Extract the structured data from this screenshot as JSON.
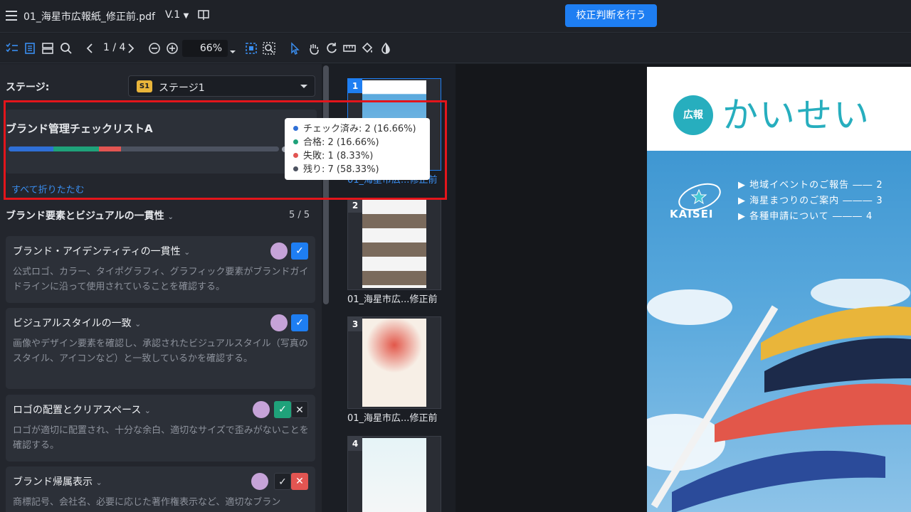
{
  "header": {
    "file_name": "01_海星市広報紙_修正前.pdf",
    "version": "V.1",
    "proof_button": "校正判断を行う"
  },
  "toolbar": {
    "page_indicator": "1 / 4",
    "zoom": "66%"
  },
  "stage": {
    "label": "ステージ:",
    "badge": "S1",
    "selected": "ステージ1"
  },
  "checklist": {
    "title": "ブランド管理チェックリストA",
    "collapse_all": "すべて折りたたむ",
    "progress": [
      {
        "name": "checked",
        "fraction": 0.1666,
        "color": "#2f6fd6"
      },
      {
        "name": "passed",
        "fraction": 0.1666,
        "color": "#1fa27a"
      },
      {
        "name": "failed",
        "fraction": 0.0833,
        "color": "#e25552"
      }
    ],
    "tooltip": [
      {
        "label": "チェック済み: 2 (16.66%)",
        "color": "#2f6fd6"
      },
      {
        "label": "合格: 2 (16.66%)",
        "color": "#1fa27a"
      },
      {
        "label": "失敗: 1 (8.33%)",
        "color": "#e25552"
      },
      {
        "label": "残り: 7 (58.33%)",
        "color": "#4c5260"
      }
    ]
  },
  "section": {
    "title": "ブランド要素とビジュアルの一貫性",
    "count": "5 / 5"
  },
  "items": [
    {
      "title": "ブランド・アイデンティティの一貫性",
      "desc": "公式ロゴ、カラー、タイポグラフィ、グラフィック要素がブランドガイドラインに沿って使用されていることを確認する。"
    },
    {
      "title": "ビジュアルスタイルの一致",
      "desc": "画像やデザイン要素を確認し、承認されたビジュアルスタイル（写真のスタイル、アイコンなど）と一致しているかを確認する。"
    },
    {
      "title": "ロゴの配置とクリアスペース",
      "desc": "ロゴが適切に配置され、十分な余白、適切なサイズで歪みがないことを確認する。"
    },
    {
      "title": "ブランド帰属表示",
      "desc": "商標記号、会社名、必要に応じた著作権表示など、適切なブラン"
    }
  ],
  "thumbnails": [
    {
      "num": "1",
      "caption": "01_海星市広...修正前"
    },
    {
      "num": "2",
      "caption": "01_海星市広...修正前"
    },
    {
      "num": "3",
      "caption": "01_海星市広...修正前"
    },
    {
      "num": "4",
      "caption": ""
    }
  ],
  "document": {
    "koho": "広報",
    "brand_title": "かいせい",
    "kaisei": "KAISEI",
    "toc": [
      "▶ 地域イベントのご報告 ―― 2",
      "▶ 海星まつりのご案内 ――― 3",
      "▶ 各種申請について ――― 4"
    ]
  }
}
